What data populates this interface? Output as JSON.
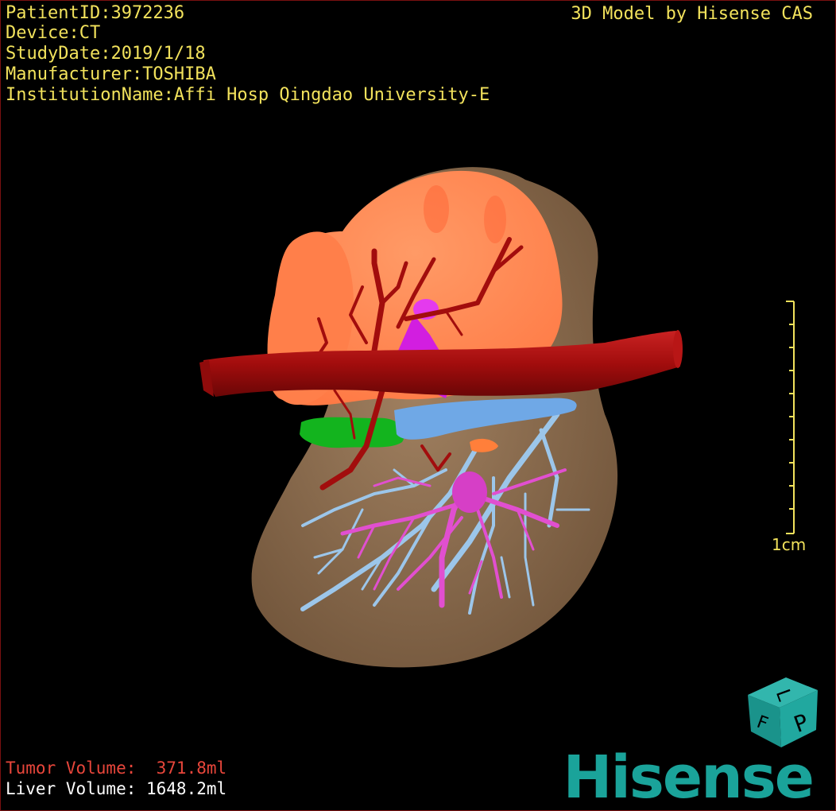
{
  "header_info": {
    "patient_id": "PatientID:3972236",
    "device": "Device:CT",
    "study_date": "StudyDate:2019/1/18",
    "manufacturer": "Manufacturer:TOSHIBA",
    "institution": "InstitutionName:Affi Hosp Qingdao University-E"
  },
  "brand_credit": "3D Model by Hisense CAS",
  "scale_bar": {
    "label": "1cm",
    "color": "#f2e25c"
  },
  "orientation_cube": {
    "face_top": "L",
    "face_front": "P",
    "face_side": "F",
    "color": "#1aa39a"
  },
  "volumes": {
    "tumor": "Tumor Volume:  371.8ml",
    "liver": "Liver Volume: 1648.2ml"
  },
  "logo": {
    "text": "Hisense",
    "color": "#1aa39a"
  },
  "structure_colors": {
    "liver": "#8a6a4a",
    "tumor": "#ff7a45",
    "artery": "#a80f0f",
    "portal_vein": "#e14fd0",
    "hepatic_vein": "#9cc6ea",
    "vena_cava": "#6fa8e6",
    "gallbladder": "#13b41e",
    "tumor_feeder": "#d21ee0"
  }
}
